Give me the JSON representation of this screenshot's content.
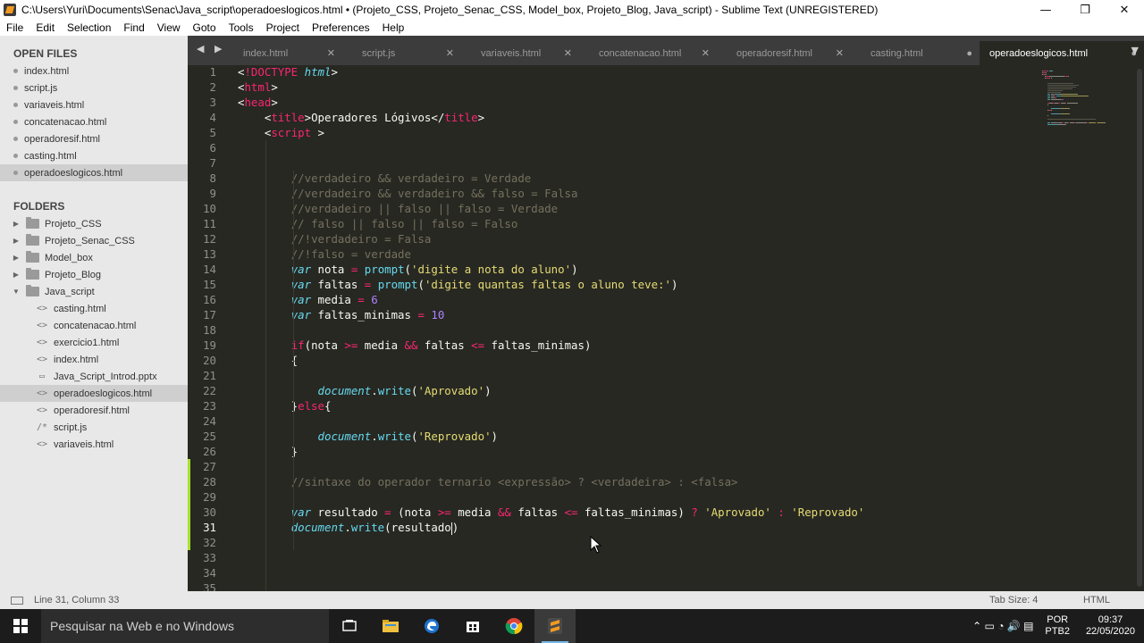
{
  "window": {
    "title": "C:\\Users\\Yuri\\Documents\\Senac\\Java_script\\operadoeslogicos.html • (Projeto_CSS, Projeto_Senac_CSS, Model_box, Projeto_Blog, Java_script) - Sublime Text (UNREGISTERED)",
    "minimize": "—",
    "maximize": "❐",
    "close": "✕"
  },
  "menu": [
    "File",
    "Edit",
    "Selection",
    "Find",
    "View",
    "Goto",
    "Tools",
    "Project",
    "Preferences",
    "Help"
  ],
  "sidebar": {
    "open_files_heading": "OPEN FILES",
    "open_files": [
      {
        "label": "index.html",
        "selected": false
      },
      {
        "label": "script.js",
        "selected": false
      },
      {
        "label": "variaveis.html",
        "selected": false
      },
      {
        "label": "concatenacao.html",
        "selected": false
      },
      {
        "label": "operadoresif.html",
        "selected": false
      },
      {
        "label": "casting.html",
        "selected": false
      },
      {
        "label": "operadoeslogicos.html",
        "selected": true
      }
    ],
    "folders_heading": "FOLDERS",
    "folders": [
      {
        "label": "Projeto_CSS",
        "expanded": false
      },
      {
        "label": "Projeto_Senac_CSS",
        "expanded": false
      },
      {
        "label": "Model_box",
        "expanded": false
      },
      {
        "label": "Projeto_Blog",
        "expanded": false
      },
      {
        "label": "Java_script",
        "expanded": true
      }
    ],
    "java_script_files": [
      {
        "label": "casting.html",
        "icon": "<>",
        "selected": false
      },
      {
        "label": "concatenacao.html",
        "icon": "<>",
        "selected": false
      },
      {
        "label": "exercicio1.html",
        "icon": "<>",
        "selected": false
      },
      {
        "label": "index.html",
        "icon": "<>",
        "selected": false
      },
      {
        "label": "Java_Script_Introd.pptx",
        "icon": "▭",
        "selected": false
      },
      {
        "label": "operadoeslogicos.html",
        "icon": "<>",
        "selected": true
      },
      {
        "label": "operadoresif.html",
        "icon": "<>",
        "selected": false
      },
      {
        "label": "script.js",
        "icon": "/*",
        "selected": false
      },
      {
        "label": "variaveis.html",
        "icon": "<>",
        "selected": false
      }
    ]
  },
  "tabs": [
    {
      "label": "index.html",
      "close": "✕",
      "active": false
    },
    {
      "label": "script.js",
      "close": "✕",
      "active": false
    },
    {
      "label": "variaveis.html",
      "close": "✕",
      "active": false
    },
    {
      "label": "concatenacao.html",
      "close": "✕",
      "active": false
    },
    {
      "label": "operadoresif.html",
      "close": "✕",
      "active": false
    },
    {
      "label": "casting.html",
      "close": "●",
      "active": false
    },
    {
      "label": "operadoeslogicos.html",
      "close": "●",
      "active": true
    }
  ],
  "tab_nav": "◀ ▶",
  "tab_dropdown": "▼",
  "editor": {
    "current_line": 31,
    "lines": [
      [
        [
          "p",
          "<"
        ],
        [
          "t",
          "!DOCTYPE"
        ],
        [
          "p",
          " "
        ],
        [
          "k",
          "html"
        ],
        [
          "p",
          ">"
        ]
      ],
      [
        [
          "p",
          "<"
        ],
        [
          "t",
          "html"
        ],
        [
          "p",
          ">"
        ]
      ],
      [
        [
          "p",
          "<"
        ],
        [
          "t",
          "head"
        ],
        [
          "p",
          ">"
        ]
      ],
      [
        [
          "p",
          "    <"
        ],
        [
          "t",
          "title"
        ],
        [
          "p",
          ">Operadores Lógivos</"
        ],
        [
          "t",
          "title"
        ],
        [
          "p",
          ">"
        ]
      ],
      [
        [
          "p",
          "    <"
        ],
        [
          "t",
          "script"
        ],
        [
          "p",
          " >"
        ]
      ],
      [],
      [],
      [
        [
          "p",
          "        "
        ],
        [
          "c",
          "//verdadeiro && verdadeiro = Verdade"
        ]
      ],
      [
        [
          "p",
          "        "
        ],
        [
          "c",
          "//verdadeiro && verdadeiro && falso = Falsa"
        ]
      ],
      [
        [
          "p",
          "        "
        ],
        [
          "c",
          "//verdadeiro || falso || falso = Verdade"
        ]
      ],
      [
        [
          "p",
          "        "
        ],
        [
          "c",
          "// falso || falso || falso = Falso"
        ]
      ],
      [
        [
          "p",
          "        "
        ],
        [
          "c",
          "//!verdadeiro = Falsa"
        ]
      ],
      [
        [
          "p",
          "        "
        ],
        [
          "c",
          "//!falso = verdade"
        ]
      ],
      [
        [
          "p",
          "        "
        ],
        [
          "i",
          "var"
        ],
        [
          "p",
          " nota "
        ],
        [
          "o",
          "="
        ],
        [
          "p",
          " "
        ],
        [
          "f",
          "prompt"
        ],
        [
          "p",
          "("
        ],
        [
          "s",
          "'digite a nota do aluno'"
        ],
        [
          "p",
          ")"
        ]
      ],
      [
        [
          "p",
          "        "
        ],
        [
          "i",
          "var"
        ],
        [
          "p",
          " faltas "
        ],
        [
          "o",
          "="
        ],
        [
          "p",
          " "
        ],
        [
          "f",
          "prompt"
        ],
        [
          "p",
          "("
        ],
        [
          "s",
          "'digite quantas faltas o aluno teve:'"
        ],
        [
          "p",
          ")"
        ]
      ],
      [
        [
          "p",
          "        "
        ],
        [
          "i",
          "var"
        ],
        [
          "p",
          " media "
        ],
        [
          "o",
          "="
        ],
        [
          "p",
          " "
        ],
        [
          "n",
          "6"
        ]
      ],
      [
        [
          "p",
          "        "
        ],
        [
          "i",
          "var"
        ],
        [
          "p",
          " faltas_minimas "
        ],
        [
          "o",
          "="
        ],
        [
          "p",
          " "
        ],
        [
          "n",
          "10"
        ]
      ],
      [],
      [
        [
          "p",
          "        "
        ],
        [
          "kw",
          "if"
        ],
        [
          "p",
          "(nota "
        ],
        [
          "o",
          ">="
        ],
        [
          "p",
          " media "
        ],
        [
          "o",
          "&&"
        ],
        [
          "p",
          " faltas "
        ],
        [
          "o",
          "<="
        ],
        [
          "p",
          " faltas_minimas)"
        ]
      ],
      [
        [
          "p",
          "        {"
        ]
      ],
      [],
      [
        [
          "p",
          "            "
        ],
        [
          "i",
          "document"
        ],
        [
          "p",
          "."
        ],
        [
          "f",
          "write"
        ],
        [
          "p",
          "("
        ],
        [
          "s",
          "'Aprovado'"
        ],
        [
          "p",
          ")"
        ]
      ],
      [
        [
          "p",
          "        }"
        ],
        [
          "kw",
          "else"
        ],
        [
          "p",
          "{"
        ]
      ],
      [],
      [
        [
          "p",
          "            "
        ],
        [
          "i",
          "document"
        ],
        [
          "p",
          "."
        ],
        [
          "f",
          "write"
        ],
        [
          "p",
          "("
        ],
        [
          "s",
          "'Reprovado'"
        ],
        [
          "p",
          ")"
        ]
      ],
      [
        [
          "p",
          "        }"
        ]
      ],
      [],
      [
        [
          "p",
          "        "
        ],
        [
          "c",
          "//sintaxe do operador ternario <expressão> ? <verdadeira> : <falsa>"
        ]
      ],
      [],
      [
        [
          "p",
          "        "
        ],
        [
          "i",
          "var"
        ],
        [
          "p",
          " resultado "
        ],
        [
          "o",
          "="
        ],
        [
          "p",
          " (nota "
        ],
        [
          "o",
          ">="
        ],
        [
          "p",
          " media "
        ],
        [
          "o",
          "&&"
        ],
        [
          "p",
          " faltas "
        ],
        [
          "o",
          "<="
        ],
        [
          "p",
          " faltas_minimas) "
        ],
        [
          "o",
          "?"
        ],
        [
          "p",
          " "
        ],
        [
          "s",
          "'Aprovado'"
        ],
        [
          "p",
          " "
        ],
        [
          "o",
          ":"
        ],
        [
          "p",
          " "
        ],
        [
          "s",
          "'Reprovado'"
        ]
      ],
      [
        [
          "p",
          "        "
        ],
        [
          "i",
          "document"
        ],
        [
          "p",
          "."
        ],
        [
          "f",
          "write"
        ],
        [
          "p",
          "(resultado"
        ],
        [
          "caret",
          ""
        ],
        [
          "p",
          ")"
        ]
      ],
      [],
      [],
      [],
      []
    ]
  },
  "status": {
    "position": "Line 31, Column 33",
    "tab_size": "Tab Size: 4",
    "syntax": "HTML"
  },
  "taskbar": {
    "search_placeholder": "Pesquisar na Web e no Windows",
    "tray_icons": "⌃  ▭  ◔  🔊  ▤",
    "lang_top": "POR",
    "lang_bottom": "PTB2",
    "time": "09:37",
    "date": "22/05/2020"
  },
  "colors": {
    "editor_bg": "#272822",
    "sidebar_bg": "#e8e8e8",
    "tab_active": "#272822",
    "modified_marker": "#a6e22e",
    "accent_taskbar": "#76b9ed"
  }
}
